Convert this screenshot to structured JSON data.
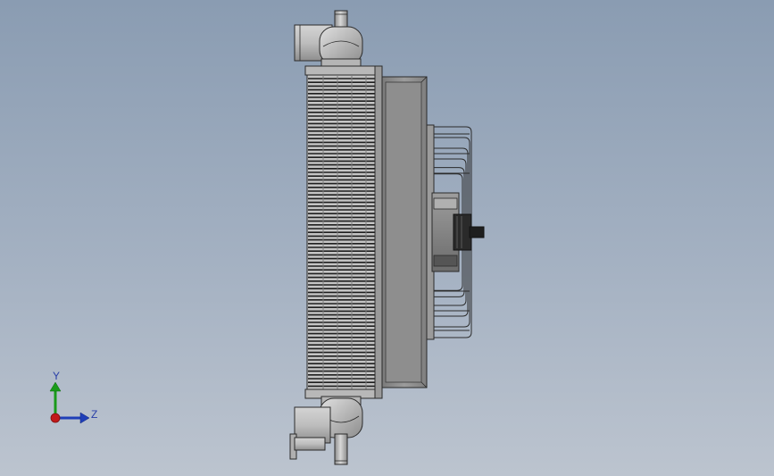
{
  "triad": {
    "y_label": "Y",
    "z_label": "Z"
  },
  "colors": {
    "background_top": "#8a9cb2",
    "background_bottom": "#bcc4cf",
    "metal_light": "#c9c9c9",
    "metal_mid": "#a9a9a9",
    "metal_dark": "#6f6f6f",
    "edge": "#2b2b2b",
    "axis_y": "#1a9a1a",
    "axis_z": "#1f3fb8",
    "origin": "#c21a1a"
  },
  "icons": [
    "axis-triad-icon"
  ]
}
